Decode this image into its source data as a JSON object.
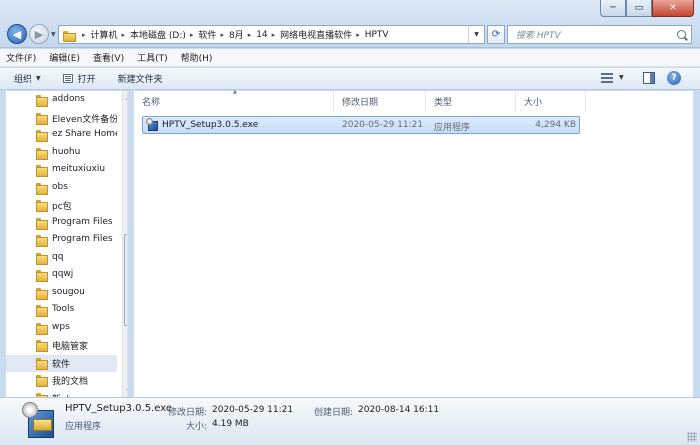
{
  "window": {
    "min_label": "─",
    "max_label": "▭",
    "close_label": "✕"
  },
  "nav": {
    "back_label": "◀",
    "forward_label": "▶",
    "dropdown_label": "▼"
  },
  "address": {
    "crumbs": [
      "计算机",
      "本地磁盘 (D:)",
      "软件",
      "8月",
      "14",
      "网络电视直播软件",
      "HPTV"
    ],
    "separator": "▸",
    "dropdown_label": "▼",
    "refresh_label": "⟳"
  },
  "search": {
    "placeholder": "搜索 HPTV"
  },
  "menu": [
    "文件(F)",
    "编辑(E)",
    "查看(V)",
    "工具(T)",
    "帮助(H)"
  ],
  "toolbar": {
    "organize_label": "组织",
    "organize_caret": "▼",
    "open_label": "打开",
    "new_folder_label": "新建文件夹",
    "view_caret": "▼",
    "help_label": "?"
  },
  "tree": [
    {
      "label": "addons",
      "selected": false
    },
    {
      "label": "Eleven文件备份",
      "selected": false
    },
    {
      "label": "ez Share Home",
      "selected": false
    },
    {
      "label": "huohu",
      "selected": false
    },
    {
      "label": "meituxiuxiu",
      "selected": false
    },
    {
      "label": "obs",
      "selected": false
    },
    {
      "label": "pc包",
      "selected": false
    },
    {
      "label": "Program Files",
      "selected": false
    },
    {
      "label": "Program Files",
      "selected": false
    },
    {
      "label": "qq",
      "selected": false
    },
    {
      "label": "qqwj",
      "selected": false
    },
    {
      "label": "sougou",
      "selected": false
    },
    {
      "label": "Tools",
      "selected": false
    },
    {
      "label": "wps",
      "selected": false
    },
    {
      "label": "电脑管家",
      "selected": false
    },
    {
      "label": "软件",
      "selected": true
    },
    {
      "label": "我的文档",
      "selected": false
    },
    {
      "label": "新obs",
      "selected": false
    }
  ],
  "scrollbar": {
    "up_label": "▲",
    "down_label": "▼"
  },
  "columns": {
    "name": "名称",
    "modified": "修改日期",
    "type": "类型",
    "size": "大小",
    "sort_indicator": "▲"
  },
  "files": [
    {
      "name": "HPTV_Setup3.0.5.exe",
      "modified": "2020-05-29 11:21",
      "type": "应用程序",
      "size": "4,294 KB"
    }
  ],
  "details": {
    "name": "HPTV_Setup3.0.5.exe",
    "type": "应用程序",
    "modified_label": "修改日期:",
    "modified_value": "2020-05-29 11:21",
    "created_label": "创建日期:",
    "created_value": "2020-08-14 16:11",
    "size_label": "大小:",
    "size_value": "4.19 MB"
  }
}
